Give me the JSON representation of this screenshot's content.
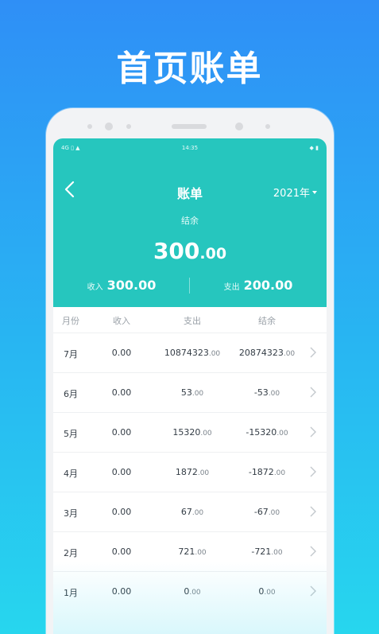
{
  "promo": {
    "title": "首页账单"
  },
  "status_bar": {
    "left": "4G ▯ ▲",
    "time": "14:35",
    "right": "◆ ▮"
  },
  "nav": {
    "title": "账单",
    "year": "2021年"
  },
  "balance": {
    "label": "结余",
    "integer": "300",
    "decimal": ".00"
  },
  "summary": {
    "income_label": "收入",
    "income_value": "300.00",
    "expense_label": "支出",
    "expense_value": "200.00"
  },
  "table": {
    "headers": {
      "month": "月份",
      "income": "收入",
      "expense": "支出",
      "balance": "结余"
    },
    "rows": [
      {
        "month": "7月",
        "income": "0.00",
        "expense_int": "10874323",
        "expense_dec": ".00",
        "balance_int": "20874323",
        "balance_dec": ".00"
      },
      {
        "month": "6月",
        "income": "0.00",
        "expense_int": "53",
        "expense_dec": ".00",
        "balance_int": "-53",
        "balance_dec": ".00"
      },
      {
        "month": "5月",
        "income": "0.00",
        "expense_int": "15320",
        "expense_dec": ".00",
        "balance_int": "-15320",
        "balance_dec": ".00"
      },
      {
        "month": "4月",
        "income": "0.00",
        "expense_int": "1872",
        "expense_dec": ".00",
        "balance_int": "-1872",
        "balance_dec": ".00"
      },
      {
        "month": "3月",
        "income": "0.00",
        "expense_int": "67",
        "expense_dec": ".00",
        "balance_int": "-67",
        "balance_dec": ".00"
      },
      {
        "month": "2月",
        "income": "0.00",
        "expense_int": "721",
        "expense_dec": ".00",
        "balance_int": "-721",
        "balance_dec": ".00"
      },
      {
        "month": "1月",
        "income": "0.00",
        "expense_int": "0",
        "expense_dec": ".00",
        "balance_int": "0",
        "balance_dec": ".00"
      }
    ]
  },
  "colors": {
    "header": "#26c6be",
    "background_top": "#2f8ff6",
    "background_bottom": "#27d6ee"
  }
}
